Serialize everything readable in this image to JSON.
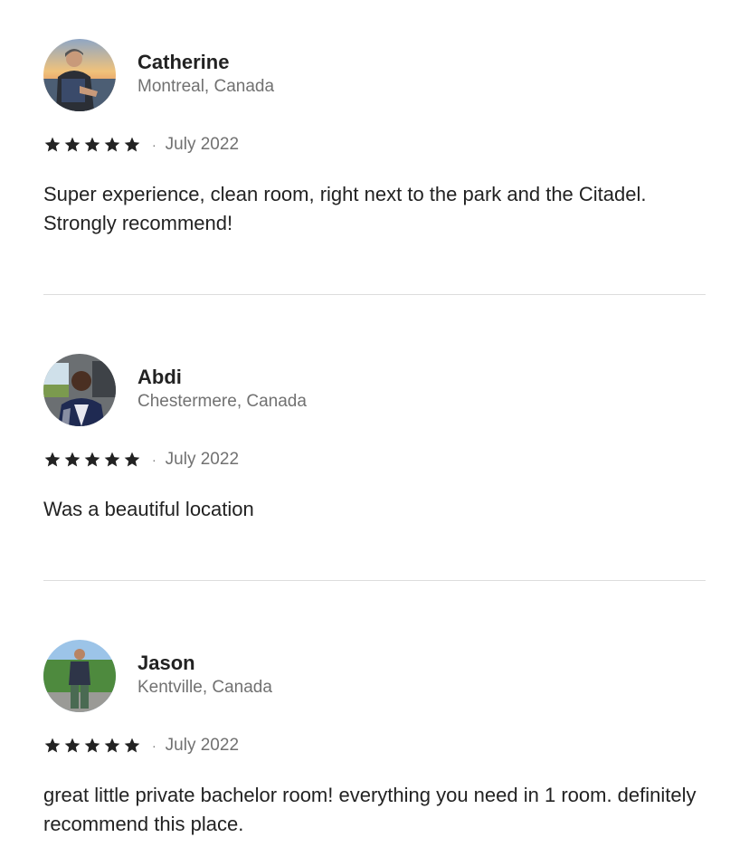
{
  "colors": {
    "text_primary": "#222222",
    "text_secondary": "#717171",
    "divider": "#dddddd",
    "star": "#222222"
  },
  "reviews": [
    {
      "name": "Catherine",
      "location": "Montreal, Canada",
      "rating": 5,
      "separator": "·",
      "date": "July 2022",
      "comment": "Super experience, clean room, right next to the park and the Citadel. Strongly recommend!",
      "avatar_icon": "avatar-photo"
    },
    {
      "name": "Abdi",
      "location": "Chestermere, Canada",
      "rating": 5,
      "separator": "·",
      "date": "July 2022",
      "comment": "Was a beautiful location",
      "avatar_icon": "avatar-photo"
    },
    {
      "name": "Jason",
      "location": "Kentville, Canada",
      "rating": 5,
      "separator": "·",
      "date": "July 2022",
      "comment": "great little private bachelor room! everything you need in 1 room. definitely recommend this place.",
      "avatar_icon": "avatar-photo"
    }
  ]
}
